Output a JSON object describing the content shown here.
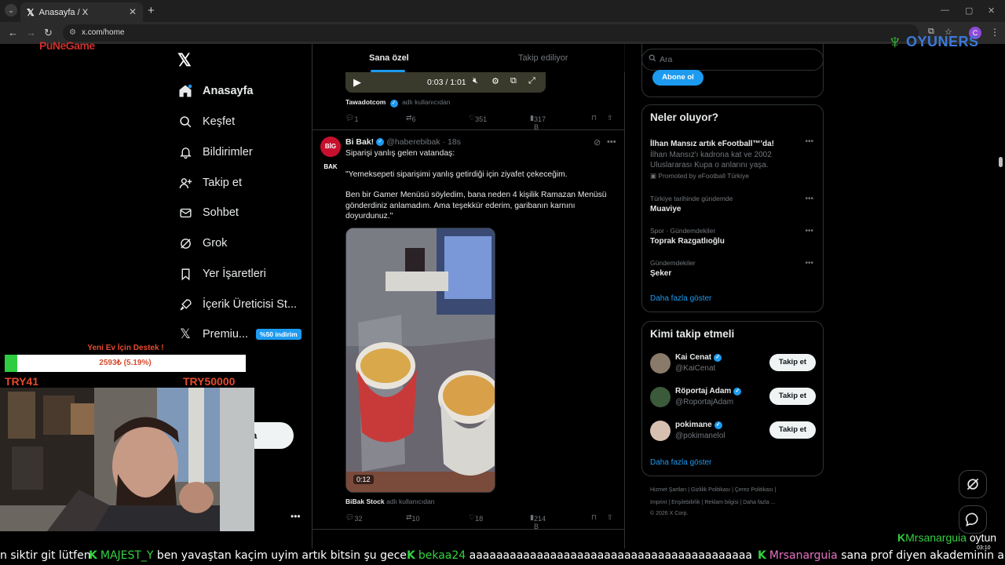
{
  "browser": {
    "tab_title": "Anasayfa / X",
    "url": "x.com/home",
    "profile_initial": "C"
  },
  "overlay": {
    "brand_left": "PuNeGame",
    "brand_right": "OYUNERS"
  },
  "sidebar": {
    "items": [
      {
        "label": "Anasayfa",
        "icon": "home-icon"
      },
      {
        "label": "Keşfet",
        "icon": "search-icon"
      },
      {
        "label": "Bildirimler",
        "icon": "bell-icon"
      },
      {
        "label": "Takip et",
        "icon": "follow-icon"
      },
      {
        "label": "Sohbet",
        "icon": "mail-icon"
      },
      {
        "label": "Grok",
        "icon": "grok-icon"
      },
      {
        "label": "Yer İşaretleri",
        "icon": "bookmark-icon"
      },
      {
        "label": "İçerik Üreticisi St...",
        "icon": "rocket-icon"
      },
      {
        "label": "Premiu...",
        "icon": "x-icon",
        "badge": "%50 indirim"
      }
    ],
    "post_button": "nla",
    "more": "•••"
  },
  "donation": {
    "title": "Yeni Ev İçin Destek !",
    "amount_text": "2593₺ (5.19%)",
    "progress": 0.0519,
    "min": "TRY41",
    "max": "TRY50000"
  },
  "feed": {
    "tabs": [
      "Sana özel",
      "Takip ediliyor"
    ],
    "audio": {
      "time": "0:03 / 1:01"
    },
    "prev_tweet": {
      "source_name": "Tawadotcom",
      "source_suffix": "adlı kullanıcıdan",
      "replies": "1",
      "reposts": "6",
      "likes": "351",
      "views": "317 B"
    },
    "tweet": {
      "avatar": "BİG BAK",
      "name": "Bi Bak!",
      "handle": "@haberebibak · 18s",
      "line1": "Siparişi yanlış gelen vatandaş:",
      "line2": "\"Yemeksepeti siparişimi yanlış getirdiği için ziyafet çekeceğim.",
      "line3": "Ben bir Gamer Menüsü söyledim, bana neden 4 kişilik Ramazan Menüsü gönderdiniz anlamadım. Ama teşekkür ederim, garibanın karnını doyurdunuz.\"",
      "video_time": "0:12",
      "source_name": "BiBak Stock",
      "source_suffix": "adlı kullanıcıdan",
      "replies": "32",
      "reposts": "10",
      "likes": "18",
      "views": "214 B"
    }
  },
  "right": {
    "search_placeholder": "Ara",
    "subscribe": "Abone ol",
    "trends_title": "Neler oluyor?",
    "trends": [
      {
        "ctx": "",
        "title": "İlhan Mansız artık eFootball™'da!",
        "desc": "İlhan Mansız'ı kadrona kat ve 2002 Uluslararası Kupa o anlarını yaşa.",
        "promo": "Promoted by eFootball Türkiye"
      },
      {
        "ctx": "Türkiye tarihinde gündemde",
        "title": "Muaviye"
      },
      {
        "ctx": "Spor · Gündemdekiler",
        "title": "Toprak Razgatlıoğlu"
      },
      {
        "ctx": "Gündemdekiler",
        "title": "Şeker"
      }
    ],
    "show_more": "Daha fazla göster",
    "wtf_title": "Kimi takip etmeli",
    "wtf": [
      {
        "name": "Kai Cenat",
        "handle": "@KaiCenat",
        "button": "Takip et"
      },
      {
        "name": "Röportaj Adam",
        "handle": "@RoportajAdam",
        "button": "Takip et"
      },
      {
        "name": "pokimane",
        "handle": "@pokimanelol",
        "button": "Takip et"
      }
    ],
    "footer1": "Hizmet Şartları  |  Gizlilik Politikası  |  Çerez Politikası  |",
    "footer2": "Imprint  |  Erişilebilirlik  |  Reklam bilgisi  |  Daha fazla ...",
    "footer3": "© 2026 X Corp."
  },
  "chat": {
    "top_user": "Mrsanarguia",
    "top_msg": " oytun",
    "msgs": [
      {
        "user": "",
        "text": "n siktir git lütfen"
      },
      {
        "user": "MAJEST_Y",
        "text": " ben yavaştan kaçim uyim artık bitsin şu gece"
      },
      {
        "user": "bekaa24",
        "text": " aaaaaaaaaaaaaaaaaaaaaaaaaaaaaaaaaaaaaaaaaa"
      },
      {
        "user": "Mrsanarguia",
        "text": " sana prof diyen akademinin amk"
      }
    ],
    "clock": "03:10"
  },
  "colors": {
    "accent": "#1d9bf0",
    "bg": "#000000",
    "border": "#2f3336",
    "muted": "#71767b",
    "chat_user": "#34d140"
  }
}
